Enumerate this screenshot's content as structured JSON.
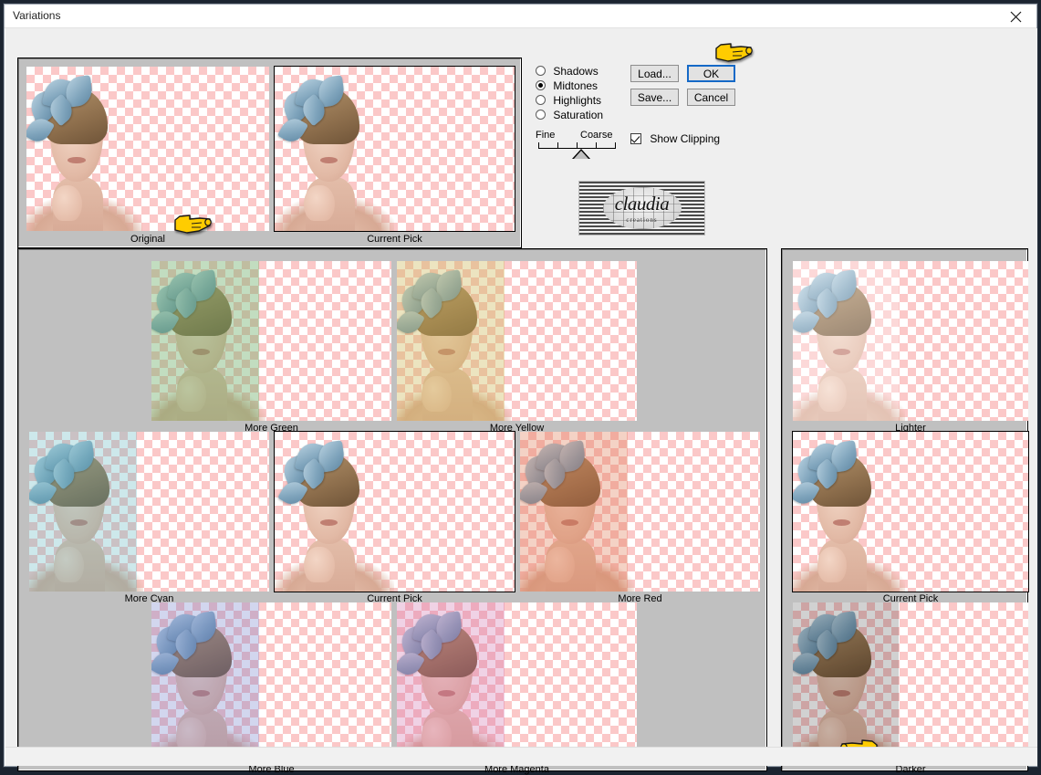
{
  "window": {
    "title": "Variations",
    "close_icon": "close-x-icon"
  },
  "options": {
    "adjust_radios": [
      {
        "label": "Shadows",
        "selected": false
      },
      {
        "label": "Midtones",
        "selected": true
      },
      {
        "label": "Highlights",
        "selected": false
      },
      {
        "label": "Saturation",
        "selected": false
      }
    ],
    "slider": {
      "min_label": "Fine",
      "max_label": "Coarse",
      "ticks": 5,
      "position": 3
    },
    "show_clipping": {
      "label": "Show Clipping",
      "checked": true
    },
    "buttons": [
      {
        "label": "Load...",
        "focused": false
      },
      {
        "label": "OK",
        "focused": true
      },
      {
        "label": "Save...",
        "focused": false
      },
      {
        "label": "Cancel",
        "focused": false
      }
    ]
  },
  "logo": {
    "word": "claudia",
    "subtitle": "creations"
  },
  "top_previews": [
    {
      "caption": "Original",
      "tint": "none",
      "framed": false
    },
    {
      "caption": "Current Pick",
      "tint": "none",
      "framed": true
    }
  ],
  "variations_grid": [
    {
      "caption": "More Green",
      "tint": "green",
      "framed": false,
      "row": 1,
      "col": 2
    },
    {
      "caption": "More Yellow",
      "tint": "yellow",
      "framed": false,
      "row": 1,
      "col": 3
    },
    {
      "caption": "More Cyan",
      "tint": "cyan",
      "framed": false,
      "row": 2,
      "col": 1
    },
    {
      "caption": "Current Pick",
      "tint": "none",
      "framed": true,
      "row": 2,
      "col": 2
    },
    {
      "caption": "More Red",
      "tint": "red",
      "framed": false,
      "row": 2,
      "col": 3
    },
    {
      "caption": "More Blue",
      "tint": "blue",
      "framed": false,
      "row": 3,
      "col": 2
    },
    {
      "caption": "More Magenta",
      "tint": "magenta",
      "framed": false,
      "row": 3,
      "col": 3
    }
  ],
  "lightness_column": [
    {
      "caption": "Lighter",
      "tint": "lighter",
      "framed": false
    },
    {
      "caption": "Current Pick",
      "tint": "none",
      "framed": true
    },
    {
      "caption": "Darker",
      "tint": "darker",
      "framed": false
    }
  ],
  "cursors": [
    {
      "name": "hand-pointer-original",
      "target": "Original"
    },
    {
      "name": "hand-pointer-ok",
      "target": "OK"
    },
    {
      "name": "hand-pointer-darker",
      "target": "Darker"
    }
  ],
  "colors": {
    "panel_gray": "#c0c0c0",
    "dialog_gray": "#efefef",
    "checker_pink": "#fbc8c8",
    "checker_white": "#ffffff",
    "focus_blue": "#1569c7",
    "cursor_yellow": "#ffcc00"
  }
}
